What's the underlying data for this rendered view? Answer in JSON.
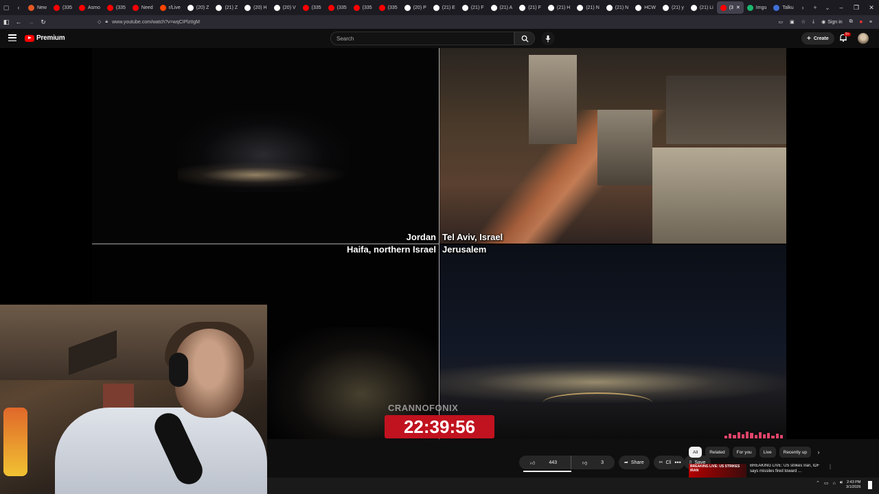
{
  "browser": {
    "tabs": [
      {
        "label": "New",
        "color": "#e25822"
      },
      {
        "label": "(335",
        "color": "#ff0000"
      },
      {
        "label": "Asmo",
        "color": "#ff0000"
      },
      {
        "label": "(335",
        "color": "#ff0000"
      },
      {
        "label": "Need",
        "color": "#ff0000"
      },
      {
        "label": "r/Live",
        "color": "#ff4500"
      },
      {
        "label": "(20) Z",
        "color": "#ffffff"
      },
      {
        "label": "(21) Z",
        "color": "#ffffff"
      },
      {
        "label": "(20) H",
        "color": "#ffffff"
      },
      {
        "label": "(20) V",
        "color": "#ffffff"
      },
      {
        "label": "(335",
        "color": "#ff0000"
      },
      {
        "label": "(335",
        "color": "#ff0000"
      },
      {
        "label": "(335",
        "color": "#ff0000"
      },
      {
        "label": "(335",
        "color": "#ff0000"
      },
      {
        "label": "(20) P",
        "color": "#ffffff"
      },
      {
        "label": "(21) E",
        "color": "#ffffff"
      },
      {
        "label": "(21) F",
        "color": "#ffffff"
      },
      {
        "label": "(21) A",
        "color": "#ffffff"
      },
      {
        "label": "(21) F",
        "color": "#ffffff"
      },
      {
        "label": "(21) H",
        "color": "#ffffff"
      },
      {
        "label": "(21) N",
        "color": "#ffffff"
      },
      {
        "label": "(21) N",
        "color": "#ffffff"
      },
      {
        "label": "HCW",
        "color": "#ffffff"
      },
      {
        "label": "(21) y",
        "color": "#ffffff"
      },
      {
        "label": "(21) Li",
        "color": "#ffffff"
      },
      {
        "label": "(3",
        "color": "#ff0000",
        "active": true
      },
      {
        "label": "Imgu",
        "color": "#1bb76e"
      },
      {
        "label": "Talku",
        "color": "#3f6fd8"
      }
    ],
    "url": "www.youtube.com/watch?v=wqCIPlztIgM",
    "sign_in": "Sign in"
  },
  "youtube": {
    "logo_text": "Premium",
    "search_placeholder": "Search",
    "create_label": "Create",
    "notification_badge": "9+"
  },
  "video": {
    "labels": {
      "jordan": "Jordan",
      "tel_aviv": "Tel Aviv, Israel",
      "haifa": "Haifa, northern Israel",
      "jerusalem": "Jerusalem"
    },
    "brand": "CRANNOFONIX",
    "clock": "22:39:56"
  },
  "actions": {
    "likes": "443",
    "dislikes": "3",
    "share": "Share",
    "clip": "Clip",
    "save": "Save"
  },
  "chips": [
    "All",
    "Related",
    "For you",
    "Live",
    "Recently up"
  ],
  "recommendation": {
    "thumb_text": "BREAKING LIVE: US STRIKES IRAN",
    "title": "BREAKING LIVE: US strikes Iran, IDF says missiles fired toward ..."
  },
  "taskbar": {
    "time": "2:43 PM",
    "date": "3/1/2026"
  }
}
